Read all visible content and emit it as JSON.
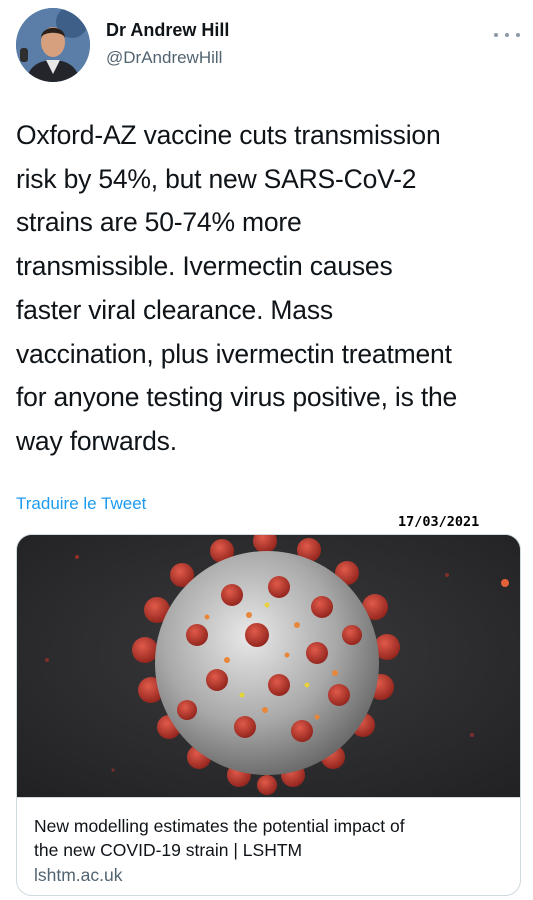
{
  "author": {
    "name": "Dr Andrew Hill",
    "handle": "@DrAndrewHill"
  },
  "tweet": {
    "lines": [
      "Oxford-AZ vaccine cuts transmission",
      "risk by 54%, but new SARS-CoV-2",
      "strains are 50-74% more",
      "transmissible.  Ivermectin causes",
      "faster viral clearance.  Mass",
      "vaccination, plus ivermectin treatment",
      "for anyone testing virus positive, is the",
      "way forwards."
    ],
    "translate_label": "Traduire le Tweet"
  },
  "stamp": {
    "date": "17/03/2021"
  },
  "link_card": {
    "title_lines": [
      "New modelling estimates the potential impact of",
      "the new COVID-19 strain | LSHTM"
    ],
    "domain": "lshtm.ac.uk",
    "image_icon": "virus-illustration"
  },
  "icons": {
    "more": "more-dots-icon",
    "avatar": "profile-photo"
  },
  "colors": {
    "link_blue": "#1d9bf0",
    "secondary_text": "#536471",
    "virus_red": "#b8322a",
    "virus_grey": "#9a9a9a"
  }
}
